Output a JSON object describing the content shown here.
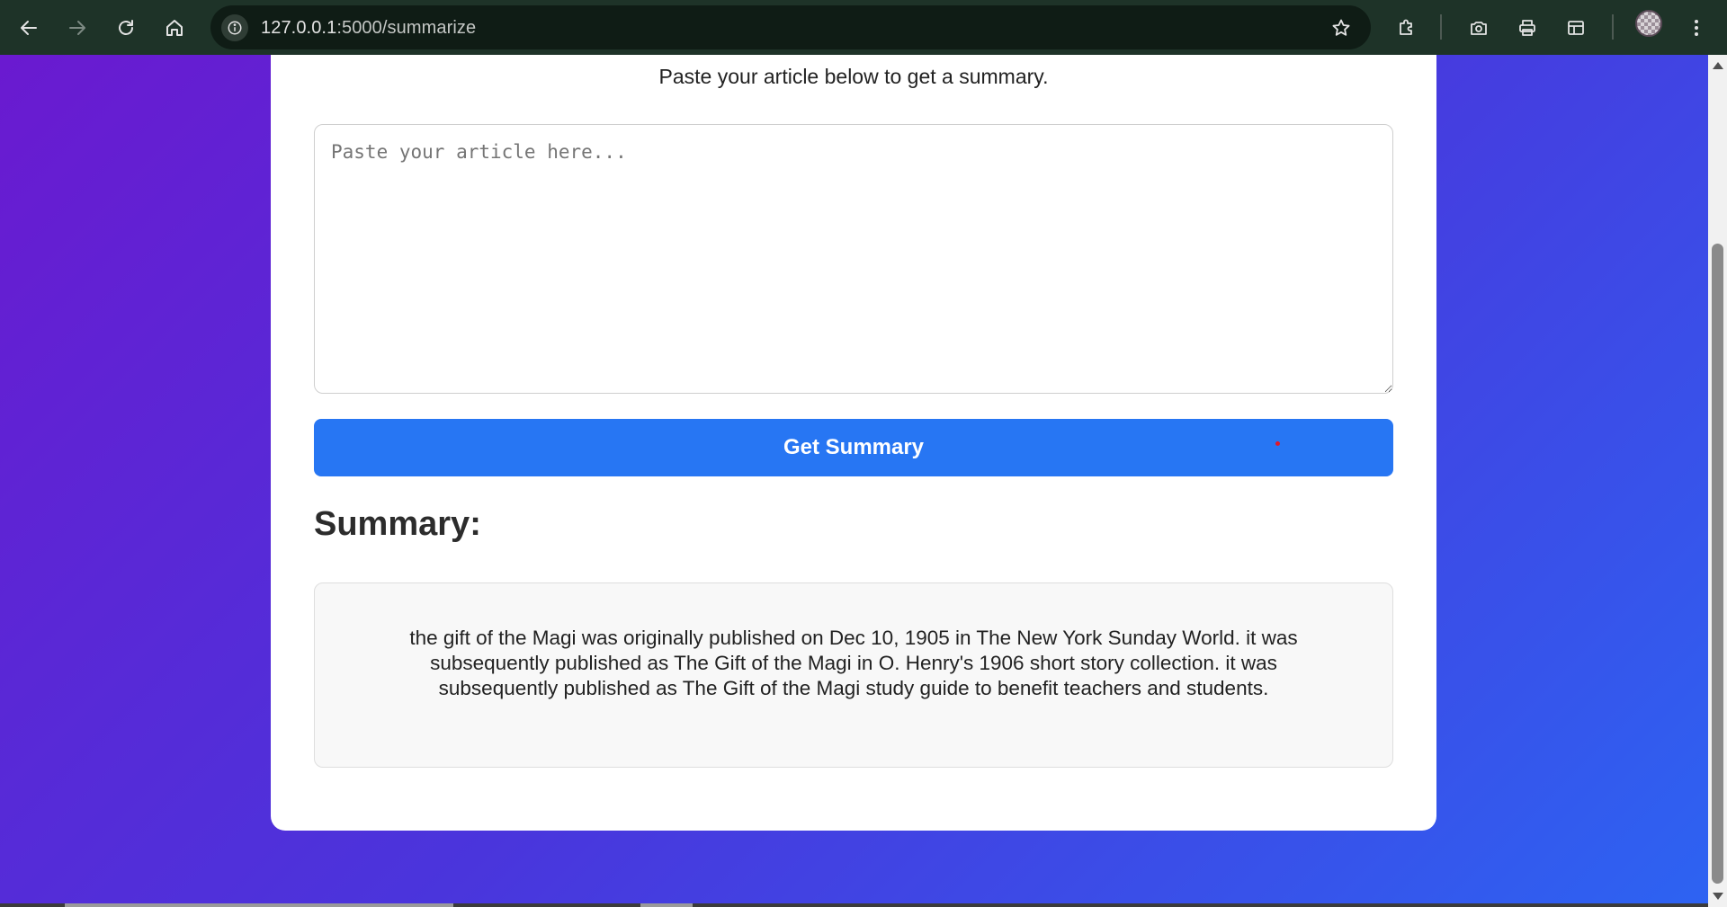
{
  "browser": {
    "url_host": "127.0.0.1",
    "url_path": ":5000/summarize",
    "icons": {
      "back": "back-arrow-icon",
      "forward": "forward-arrow-icon",
      "reload": "reload-icon",
      "home": "home-icon",
      "site_info": "info-icon",
      "bookmark": "star-icon",
      "extensions": "puzzle-icon",
      "screenshot": "camera-icon",
      "print": "printer-icon",
      "sidepanel": "layout-icon",
      "menu": "kebab-menu-icon"
    }
  },
  "page": {
    "subtitle": "Paste your article below to get a summary.",
    "input": {
      "placeholder": "Paste your article here...",
      "value": ""
    },
    "submit_label": "Get Summary",
    "summary_heading": "Summary:",
    "summary_text": "the gift of the Magi was originally published on Dec 10, 1905 in The New York Sunday World. it was subsequently published as The Gift of the Magi in O. Henry's 1906 short story collection. it was subsequently published as The Gift of the Magi study guide to benefit teachers and students."
  },
  "colors": {
    "background_gradient_start": "#6a1ad0",
    "background_gradient_end": "#2d63f2",
    "button": "#2776f3",
    "card": "#ffffff"
  }
}
